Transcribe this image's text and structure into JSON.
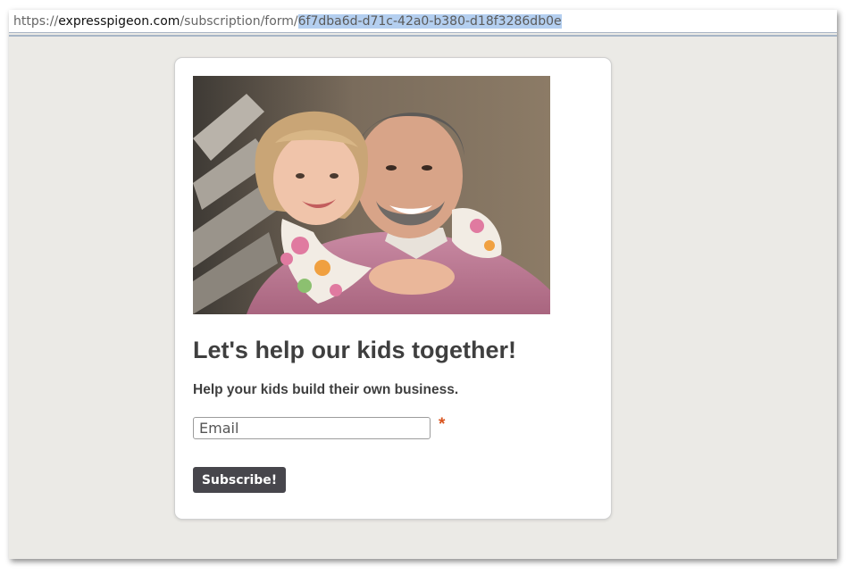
{
  "browser": {
    "url_scheme": "https://",
    "url_host": "expresspigeon.com",
    "url_path": "/subscription/form/",
    "url_selected": "6f7dba6d-d71c-42a0-b380-d18f3286db0e"
  },
  "form": {
    "image_description": "photo-father-daughter-hug",
    "headline": "Let's help our kids together!",
    "subline": "Help your kids build their own business.",
    "email_placeholder": "Email",
    "required_marker": "*",
    "subscribe_label": "Subscribe!"
  },
  "colors": {
    "page_background": "#ebeae6",
    "card_background": "#ffffff",
    "text": "#3f3f3f",
    "button": "#47464c",
    "required": "#d9541e",
    "url_selection": "#b4cff0"
  }
}
